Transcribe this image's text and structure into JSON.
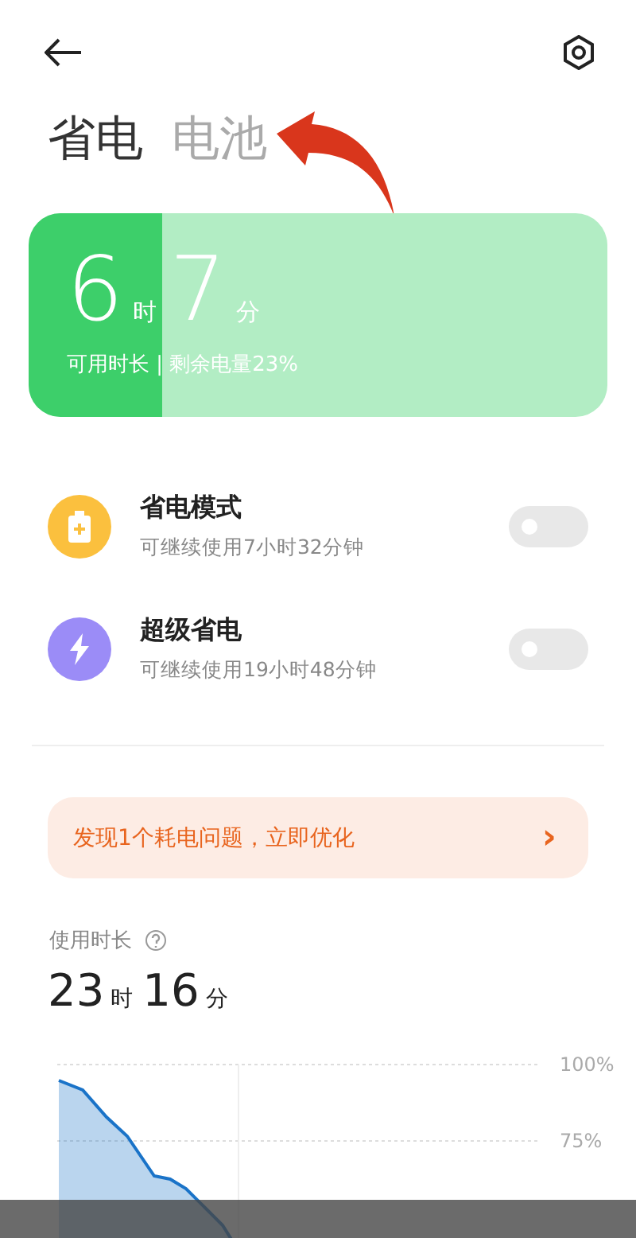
{
  "tabs": [
    {
      "label": "省电",
      "selected": true
    },
    {
      "label": "电池",
      "selected": false
    }
  ],
  "battery_card": {
    "hours": "6",
    "hours_unit": "时",
    "minutes": "7",
    "minutes_unit": "分",
    "caption": "可用时长 | 剩余电量23%",
    "level": 0.23
  },
  "modes": [
    {
      "kind": "battery",
      "color": "#fbc03e",
      "title": "省电模式",
      "subtitle": "可继续使用7小时32分钟",
      "on": false
    },
    {
      "kind": "bolt",
      "color": "#9b8cf7",
      "title": "超级省电",
      "subtitle": "可继续使用19小时48分钟",
      "on": false
    }
  ],
  "banner": {
    "text": "发现1个耗电问题，立即优化",
    "chevron": "›"
  },
  "usage": {
    "label": "使用时长",
    "hours": "23",
    "hours_unit": "时",
    "minutes": "16",
    "minutes_unit": "分",
    "axis_labels": [
      "100%",
      "75%"
    ]
  }
}
